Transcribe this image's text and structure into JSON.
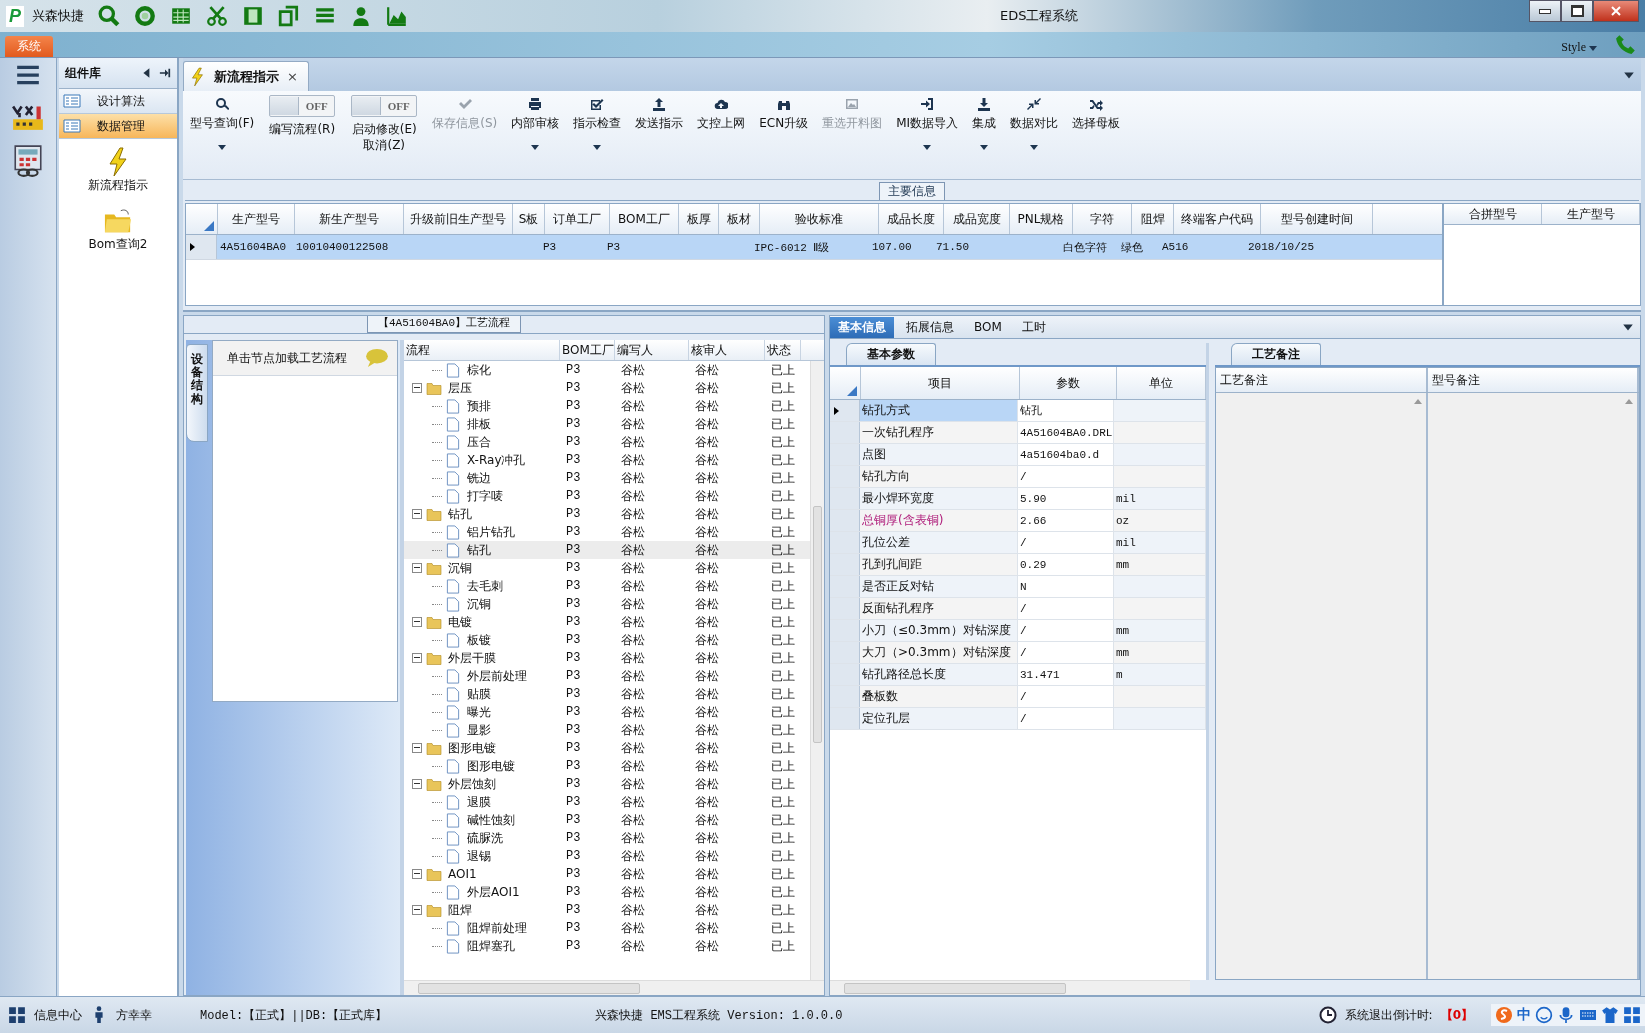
{
  "titlebar": {
    "app_logo": "P",
    "app_name": "兴森快捷",
    "title": "EDS工程系统"
  },
  "menubar": {
    "system_tab": "系统",
    "style_menu": "Style"
  },
  "component_library": {
    "title": "组件库",
    "items": [
      {
        "label": "设计算法",
        "selected": false
      },
      {
        "label": "数据管理",
        "selected": true
      }
    ],
    "tools": [
      {
        "label": "新流程指示",
        "kind": "lightning"
      },
      {
        "label": "Bom查询2",
        "kind": "folder"
      }
    ]
  },
  "document_tab": {
    "label": "新流程指示",
    "close": "×"
  },
  "ribbon": [
    {
      "kind": "button",
      "label": "型号查询(F)",
      "dropdown": true,
      "disabled": false
    },
    {
      "kind": "toggle",
      "label": "编写流程(R)",
      "on": false,
      "state_text": "OFF"
    },
    {
      "kind": "toggle",
      "label": "启动修改(E)\n取消(Z)",
      "on": false,
      "state_text": "OFF"
    },
    {
      "kind": "button",
      "label": "保存信息(S)",
      "dropdown": false,
      "disabled": true
    },
    {
      "kind": "button",
      "label": "内部审核",
      "dropdown": true,
      "disabled": false
    },
    {
      "kind": "button",
      "label": "指示检查",
      "dropdown": true,
      "disabled": false
    },
    {
      "kind": "button",
      "label": "发送指示",
      "dropdown": false,
      "disabled": false
    },
    {
      "kind": "button",
      "label": "文控上网",
      "dropdown": false,
      "disabled": false
    },
    {
      "kind": "button",
      "label": "ECN升级",
      "dropdown": false,
      "disabled": false
    },
    {
      "kind": "button",
      "label": "重选开料图",
      "dropdown": false,
      "disabled": true
    },
    {
      "kind": "button",
      "label": "MI数据导入",
      "dropdown": true,
      "disabled": false
    },
    {
      "kind": "button",
      "label": "集成",
      "dropdown": true,
      "disabled": false
    },
    {
      "kind": "button",
      "label": "数据对比",
      "dropdown": true,
      "disabled": false
    },
    {
      "kind": "button",
      "label": "选择母板",
      "dropdown": false,
      "disabled": false
    }
  ],
  "main_info": {
    "title": "主要信息",
    "columns": [
      "生产型号",
      "新生产型号",
      "升级前旧生产型号",
      "S板",
      "订单工厂",
      "BOM工厂",
      "板厚",
      "板材",
      "验收标准",
      "成品长度",
      "成品宽度",
      "PNL规格",
      "字符",
      "阻焊",
      "终端客户代码",
      "型号创建时间"
    ],
    "rows": [
      {
        "selected": true,
        "cells": [
          "4A51604BA0",
          "10010400122508",
          null,
          null,
          "P3",
          "P3",
          null,
          null,
          "IPC-6012 Ⅱ级",
          "107.00",
          "71.50",
          null,
          "白色字符",
          "绿色",
          "A516",
          "2018/10/25"
        ]
      }
    ],
    "side_columns": [
      "合拼型号",
      "生产型号"
    ]
  },
  "process_flow": {
    "title": "【4A51604BA0】工艺流程",
    "side_tab": "设备结构",
    "hint": "单击节点加载工艺流程",
    "columns": [
      "流程",
      "BOM工厂",
      "编写人",
      "核审人",
      "状态"
    ],
    "rows": [
      {
        "kind": "file",
        "name": "棕化",
        "bom": "P3",
        "writer": "谷松",
        "reviewer": "谷松",
        "status": "已上",
        "selected": false
      },
      {
        "kind": "folder",
        "name": "层压",
        "bom": "P3",
        "writer": "谷松",
        "reviewer": "谷松",
        "status": "已上",
        "selected": false,
        "expanded": true,
        "children": [
          {
            "kind": "file",
            "name": "预排",
            "bom": "P3",
            "writer": "谷松",
            "reviewer": "谷松",
            "status": "已上",
            "selected": false
          },
          {
            "kind": "file",
            "name": "排板",
            "bom": "P3",
            "writer": "谷松",
            "reviewer": "谷松",
            "status": "已上",
            "selected": false
          },
          {
            "kind": "file",
            "name": "压合",
            "bom": "P3",
            "writer": "谷松",
            "reviewer": "谷松",
            "status": "已上",
            "selected": false
          },
          {
            "kind": "file",
            "name": "X-Ray冲孔",
            "bom": "P3",
            "writer": "谷松",
            "reviewer": "谷松",
            "status": "已上",
            "selected": false
          },
          {
            "kind": "file",
            "name": "铣边",
            "bom": "P3",
            "writer": "谷松",
            "reviewer": "谷松",
            "status": "已上",
            "selected": false
          },
          {
            "kind": "file",
            "name": "打字唛",
            "bom": "P3",
            "writer": "谷松",
            "reviewer": "谷松",
            "status": "已上",
            "selected": false
          }
        ]
      },
      {
        "kind": "folder",
        "name": "钻孔",
        "bom": "P3",
        "writer": "谷松",
        "reviewer": "谷松",
        "status": "已上",
        "selected": false,
        "expanded": true,
        "children": [
          {
            "kind": "file",
            "name": "铝片钻孔",
            "bom": "P3",
            "writer": "谷松",
            "reviewer": "谷松",
            "status": "已上",
            "selected": false
          },
          {
            "kind": "file",
            "name": "钻孔",
            "bom": "P3",
            "writer": "谷松",
            "reviewer": "谷松",
            "status": "已上",
            "selected": true
          }
        ]
      },
      {
        "kind": "folder",
        "name": "沉铜",
        "bom": "P3",
        "writer": "谷松",
        "reviewer": "谷松",
        "status": "已上",
        "selected": false,
        "expanded": true,
        "children": [
          {
            "kind": "file",
            "name": "去毛刺",
            "bom": "P3",
            "writer": "谷松",
            "reviewer": "谷松",
            "status": "已上",
            "selected": false
          },
          {
            "kind": "file",
            "name": "沉铜",
            "bom": "P3",
            "writer": "谷松",
            "reviewer": "谷松",
            "status": "已上",
            "selected": false
          }
        ]
      },
      {
        "kind": "folder",
        "name": "电镀",
        "bom": "P3",
        "writer": "谷松",
        "reviewer": "谷松",
        "status": "已上",
        "selected": false,
        "expanded": true,
        "children": [
          {
            "kind": "file",
            "name": "板镀",
            "bom": "P3",
            "writer": "谷松",
            "reviewer": "谷松",
            "status": "已上",
            "selected": false
          }
        ]
      },
      {
        "kind": "folder",
        "name": "外层干膜",
        "bom": "P3",
        "writer": "谷松",
        "reviewer": "谷松",
        "status": "已上",
        "selected": false,
        "expanded": true,
        "children": [
          {
            "kind": "file",
            "name": "外层前处理",
            "bom": "P3",
            "writer": "谷松",
            "reviewer": "谷松",
            "status": "已上",
            "selected": false
          },
          {
            "kind": "file",
            "name": "贴膜",
            "bom": "P3",
            "writer": "谷松",
            "reviewer": "谷松",
            "status": "已上",
            "selected": false
          },
          {
            "kind": "file",
            "name": "曝光",
            "bom": "P3",
            "writer": "谷松",
            "reviewer": "谷松",
            "status": "已上",
            "selected": false
          },
          {
            "kind": "file",
            "name": "显影",
            "bom": "P3",
            "writer": "谷松",
            "reviewer": "谷松",
            "status": "已上",
            "selected": false
          }
        ]
      },
      {
        "kind": "folder",
        "name": "图形电镀",
        "bom": "P3",
        "writer": "谷松",
        "reviewer": "谷松",
        "status": "已上",
        "selected": false,
        "expanded": true,
        "children": [
          {
            "kind": "file",
            "name": "图形电镀",
            "bom": "P3",
            "writer": "谷松",
            "reviewer": "谷松",
            "status": "已上",
            "selected": false
          }
        ]
      },
      {
        "kind": "folder",
        "name": "外层蚀刻",
        "bom": "P3",
        "writer": "谷松",
        "reviewer": "谷松",
        "status": "已上",
        "selected": false,
        "expanded": true,
        "children": [
          {
            "kind": "file",
            "name": "退膜",
            "bom": "P3",
            "writer": "谷松",
            "reviewer": "谷松",
            "status": "已上",
            "selected": false
          },
          {
            "kind": "file",
            "name": "碱性蚀刻",
            "bom": "P3",
            "writer": "谷松",
            "reviewer": "谷松",
            "status": "已上",
            "selected": false
          },
          {
            "kind": "file",
            "name": "硫脲洗",
            "bom": "P3",
            "writer": "谷松",
            "reviewer": "谷松",
            "status": "已上",
            "selected": false
          },
          {
            "kind": "file",
            "name": "退锡",
            "bom": "P3",
            "writer": "谷松",
            "reviewer": "谷松",
            "status": "已上",
            "selected": false
          }
        ]
      },
      {
        "kind": "folder",
        "name": "AOI1",
        "bom": "P3",
        "writer": "谷松",
        "reviewer": "谷松",
        "status": "已上",
        "selected": false,
        "expanded": true,
        "children": [
          {
            "kind": "file",
            "name": "外层AOI1",
            "bom": "P3",
            "writer": "谷松",
            "reviewer": "谷松",
            "status": "已上",
            "selected": false
          }
        ]
      },
      {
        "kind": "folder",
        "name": "阻焊",
        "bom": "P3",
        "writer": "谷松",
        "reviewer": "谷松",
        "status": "已上",
        "selected": false,
        "expanded": true,
        "children": [
          {
            "kind": "file",
            "name": "阻焊前处理",
            "bom": "P3",
            "writer": "谷松",
            "reviewer": "谷松",
            "status": "已上",
            "selected": false
          },
          {
            "kind": "file",
            "name": "阻焊塞孔",
            "bom": "P3",
            "writer": "谷松",
            "reviewer": "谷松",
            "status": "已上",
            "selected": false
          }
        ]
      }
    ]
  },
  "detail": {
    "tabs": [
      {
        "label": "基本信息",
        "selected": true
      },
      {
        "label": "拓展信息",
        "selected": false
      },
      {
        "label": "BOM",
        "selected": false
      },
      {
        "label": "工时",
        "selected": false
      }
    ],
    "params": {
      "title": "基本参数",
      "columns": [
        "项目",
        "参数",
        "单位"
      ],
      "rows": [
        {
          "item": "钻孔方式",
          "value": "钻孔",
          "selected": true,
          "flagged": false
        },
        {
          "item": "一次钻孔程序",
          "value": "4A51604BA0.DRL",
          "selected": false,
          "flagged": false
        },
        {
          "item": "点图",
          "value": "4a51604ba0.d",
          "selected": false,
          "flagged": false
        },
        {
          "item": "钻孔方向",
          "value": "/",
          "selected": false,
          "flagged": false
        },
        {
          "item": "最小焊环宽度",
          "value": "5.90",
          "unit": "mil",
          "selected": false,
          "flagged": false
        },
        {
          "item": "总铜厚(含表铜)",
          "value": "2.66",
          "unit": "oz",
          "selected": false,
          "flagged": true
        },
        {
          "item": "孔位公差",
          "value": "/",
          "unit": "mil",
          "selected": false,
          "flagged": false
        },
        {
          "item": "孔到孔间距",
          "value": "0.29",
          "unit": "mm",
          "selected": false,
          "flagged": false
        },
        {
          "item": "是否正反对钻",
          "value": "N",
          "selected": false,
          "flagged": false
        },
        {
          "item": "反面钻孔程序",
          "value": "/",
          "selected": false,
          "flagged": false
        },
        {
          "item": "小刀（≤0.3mm）对钻深度",
          "value": "/",
          "unit": "mm",
          "selected": false,
          "flagged": false
        },
        {
          "item": "大刀（>0.3mm）对钻深度",
          "value": "/",
          "unit": "mm",
          "selected": false,
          "flagged": false
        },
        {
          "item": "钻孔路径总长度",
          "value": "31.471",
          "unit": "m",
          "selected": false,
          "flagged": false
        },
        {
          "item": "叠板数",
          "value": "/",
          "selected": false,
          "flagged": false
        },
        {
          "item": "定位孔层",
          "value": "/",
          "selected": false,
          "flagged": false
        }
      ]
    },
    "notes": {
      "title": "工艺备注",
      "columns": [
        "工艺备注",
        "型号备注"
      ]
    }
  },
  "status_bar": {
    "info_center": "信息中心",
    "user": "方幸幸",
    "db": "Model:【正式】||DB:【正式库】",
    "version": "兴森快捷 EMS工程系统 Version: 1.0.0.0",
    "countdown_label": "系统退出倒计时:",
    "countdown": "【0】",
    "ime": "中"
  }
}
